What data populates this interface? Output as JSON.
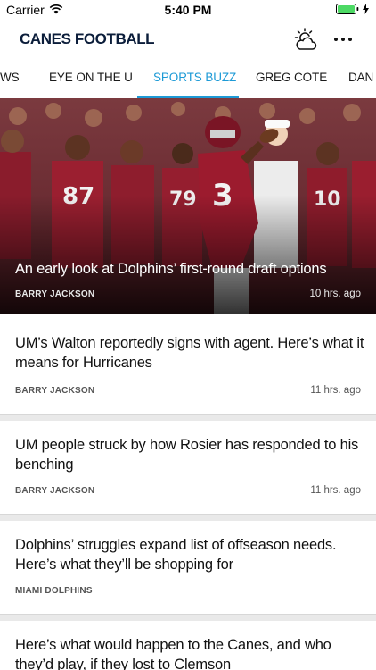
{
  "status_bar": {
    "carrier": "Carrier",
    "time": "5:40 PM"
  },
  "header": {
    "title": "CANES FOOTBALL",
    "weather_icon": "partly-cloudy-icon",
    "more_icon": "more-horizontal-icon"
  },
  "tabs": [
    {
      "label": "WS",
      "active": false
    },
    {
      "label": "EYE ON THE U",
      "active": false
    },
    {
      "label": "SPORTS BUZZ",
      "active": true
    },
    {
      "label": "GREG COTE",
      "active": false
    },
    {
      "label": "DAN",
      "active": false
    }
  ],
  "colors": {
    "accent": "#1d9ad6",
    "title": "#0b1d3a"
  },
  "hero": {
    "title": "An early look at Dolphins’ first-round draft options",
    "author": "BARRY JACKSON",
    "time": "10 hrs. ago"
  },
  "stories": [
    {
      "title": "UM’s Walton reportedly signs with agent. Here’s what it means for Hurricanes",
      "author": "BARRY JACKSON",
      "time": "11 hrs. ago"
    },
    {
      "title": "UM people struck by how Rosier has responded to his benching",
      "author": "BARRY JACKSON",
      "time": "11 hrs. ago"
    },
    {
      "title": "Dolphins’ struggles expand list of offseason needs. Here’s what they’ll be shopping for",
      "author": "MIAMI DOLPHINS",
      "time": ""
    },
    {
      "title": "Here’s what would happen to the Canes, and who they’d play, if they lost to Clemson",
      "author": "",
      "time": ""
    }
  ]
}
